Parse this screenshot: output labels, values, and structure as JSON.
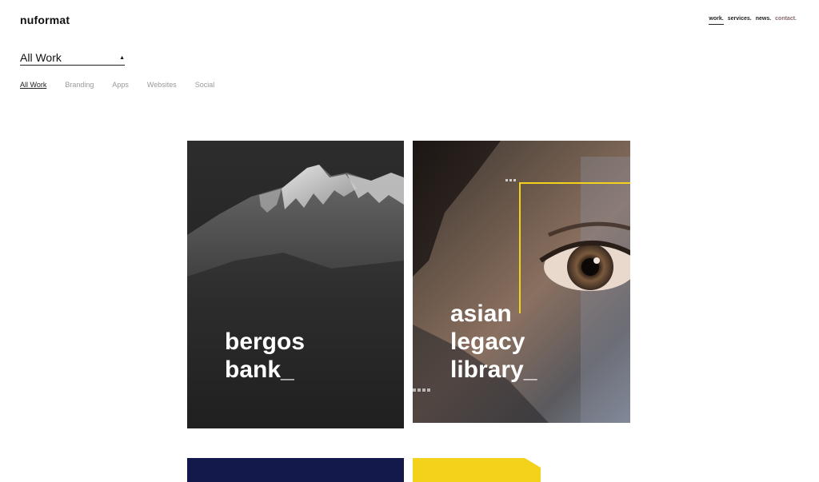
{
  "header": {
    "logo": "nuformat",
    "nav": [
      {
        "label": "work.",
        "active": true
      },
      {
        "label": "services.",
        "active": false
      },
      {
        "label": "news.",
        "active": false
      },
      {
        "label": "contact.",
        "active": false
      }
    ]
  },
  "filter": {
    "selected": "All Work",
    "caret_icon": "triangle-up-icon"
  },
  "tabs": [
    "All Work",
    "Branding",
    "Apps",
    "Websites",
    "Social"
  ],
  "projects": [
    {
      "title": "bergos\nbank_",
      "image": "snowy-mountain-peak"
    },
    {
      "title": "asian\nlegacy\nlibrary_",
      "image": "close-up-eye-with-yellow-frame"
    },
    {
      "title": "",
      "image": "navy-block"
    },
    {
      "title": "",
      "image": "yellow-shape"
    }
  ],
  "colors": {
    "accent_yellow": "#f2d21b",
    "navy": "#13194a",
    "contact_link": "#8a6a6a"
  }
}
